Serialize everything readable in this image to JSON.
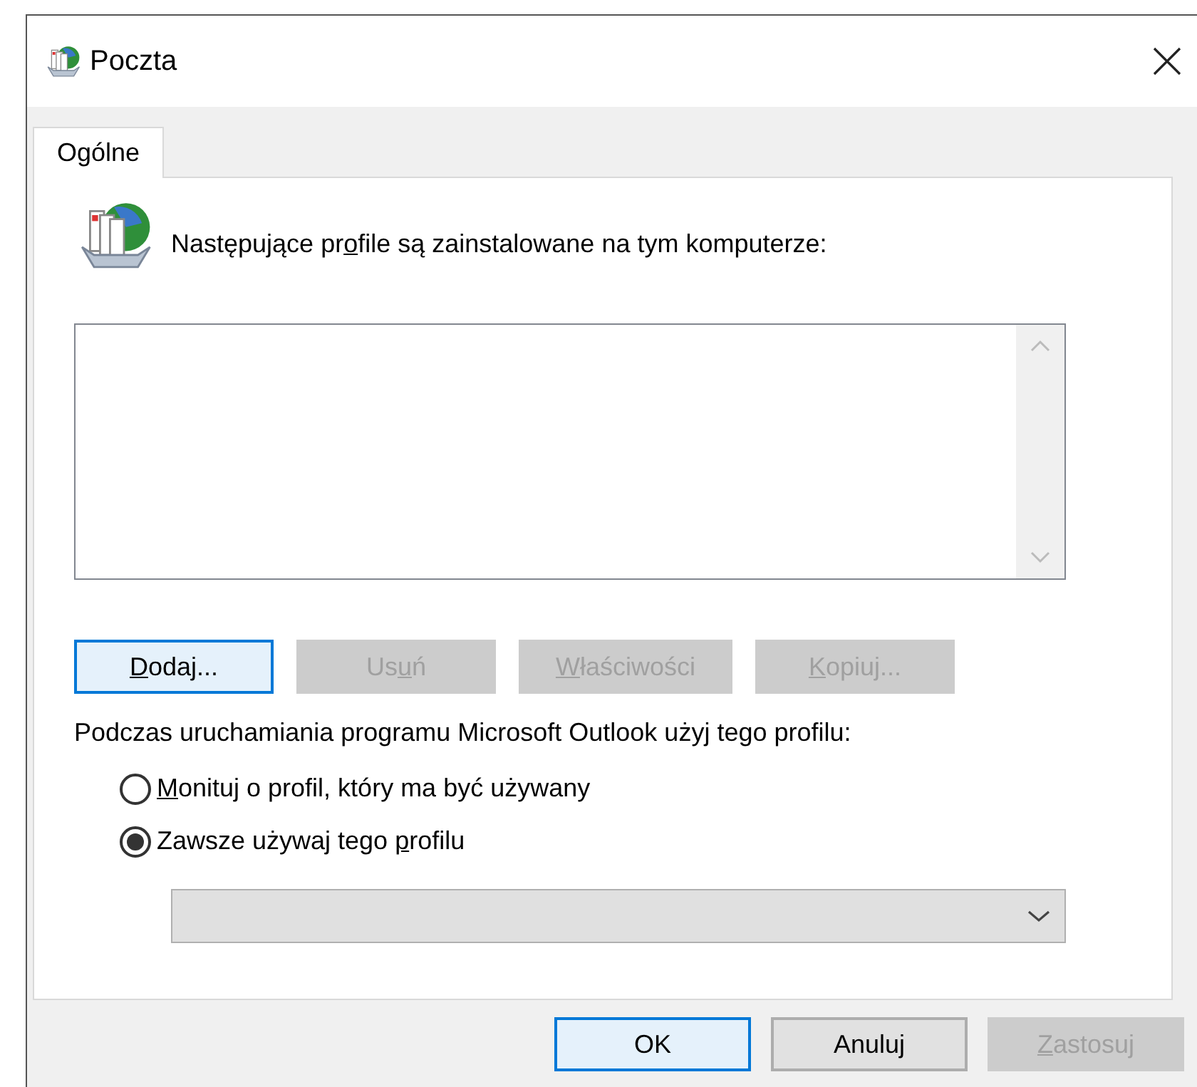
{
  "window": {
    "title": "Poczta"
  },
  "tabs": [
    {
      "label": "Ogólne",
      "selected": true
    }
  ],
  "profiles": {
    "heading": {
      "before": "Następujące pr",
      "key": "o",
      "after": "file są zainstalowane na tym komputerze:"
    }
  },
  "profile_buttons": [
    {
      "label": {
        "key": "D",
        "after": "odaj..."
      },
      "disabled": false,
      "focused": true
    },
    {
      "label": {
        "before": "Us",
        "key": "u",
        "after": "ń"
      },
      "disabled": true,
      "focused": false
    },
    {
      "label": {
        "key": "W",
        "after": "łaściwości"
      },
      "disabled": true,
      "focused": false
    },
    {
      "label": {
        "key": "K",
        "after": "opiuj..."
      },
      "disabled": true,
      "focused": false
    }
  ],
  "startup": {
    "label": "Podczas uruchamiania programu Microsoft Outlook użyj tego profilu:",
    "options": [
      {
        "label": {
          "key": "M",
          "after": "onituj o profil, który ma być używany"
        },
        "selected": false
      },
      {
        "label": {
          "before": "Zawsze używaj tego ",
          "key": "p",
          "after": "rofilu"
        },
        "selected": true
      }
    ],
    "profile_select": {
      "disabled": true
    }
  },
  "dialog_buttons": [
    {
      "label": {
        "after": "OK"
      },
      "disabled": false,
      "focused": true
    },
    {
      "label": {
        "after": "Anuluj"
      },
      "disabled": false,
      "focused": false
    },
    {
      "label": {
        "key": "Z",
        "after": "astosuj"
      },
      "disabled": true,
      "focused": false
    }
  ]
}
